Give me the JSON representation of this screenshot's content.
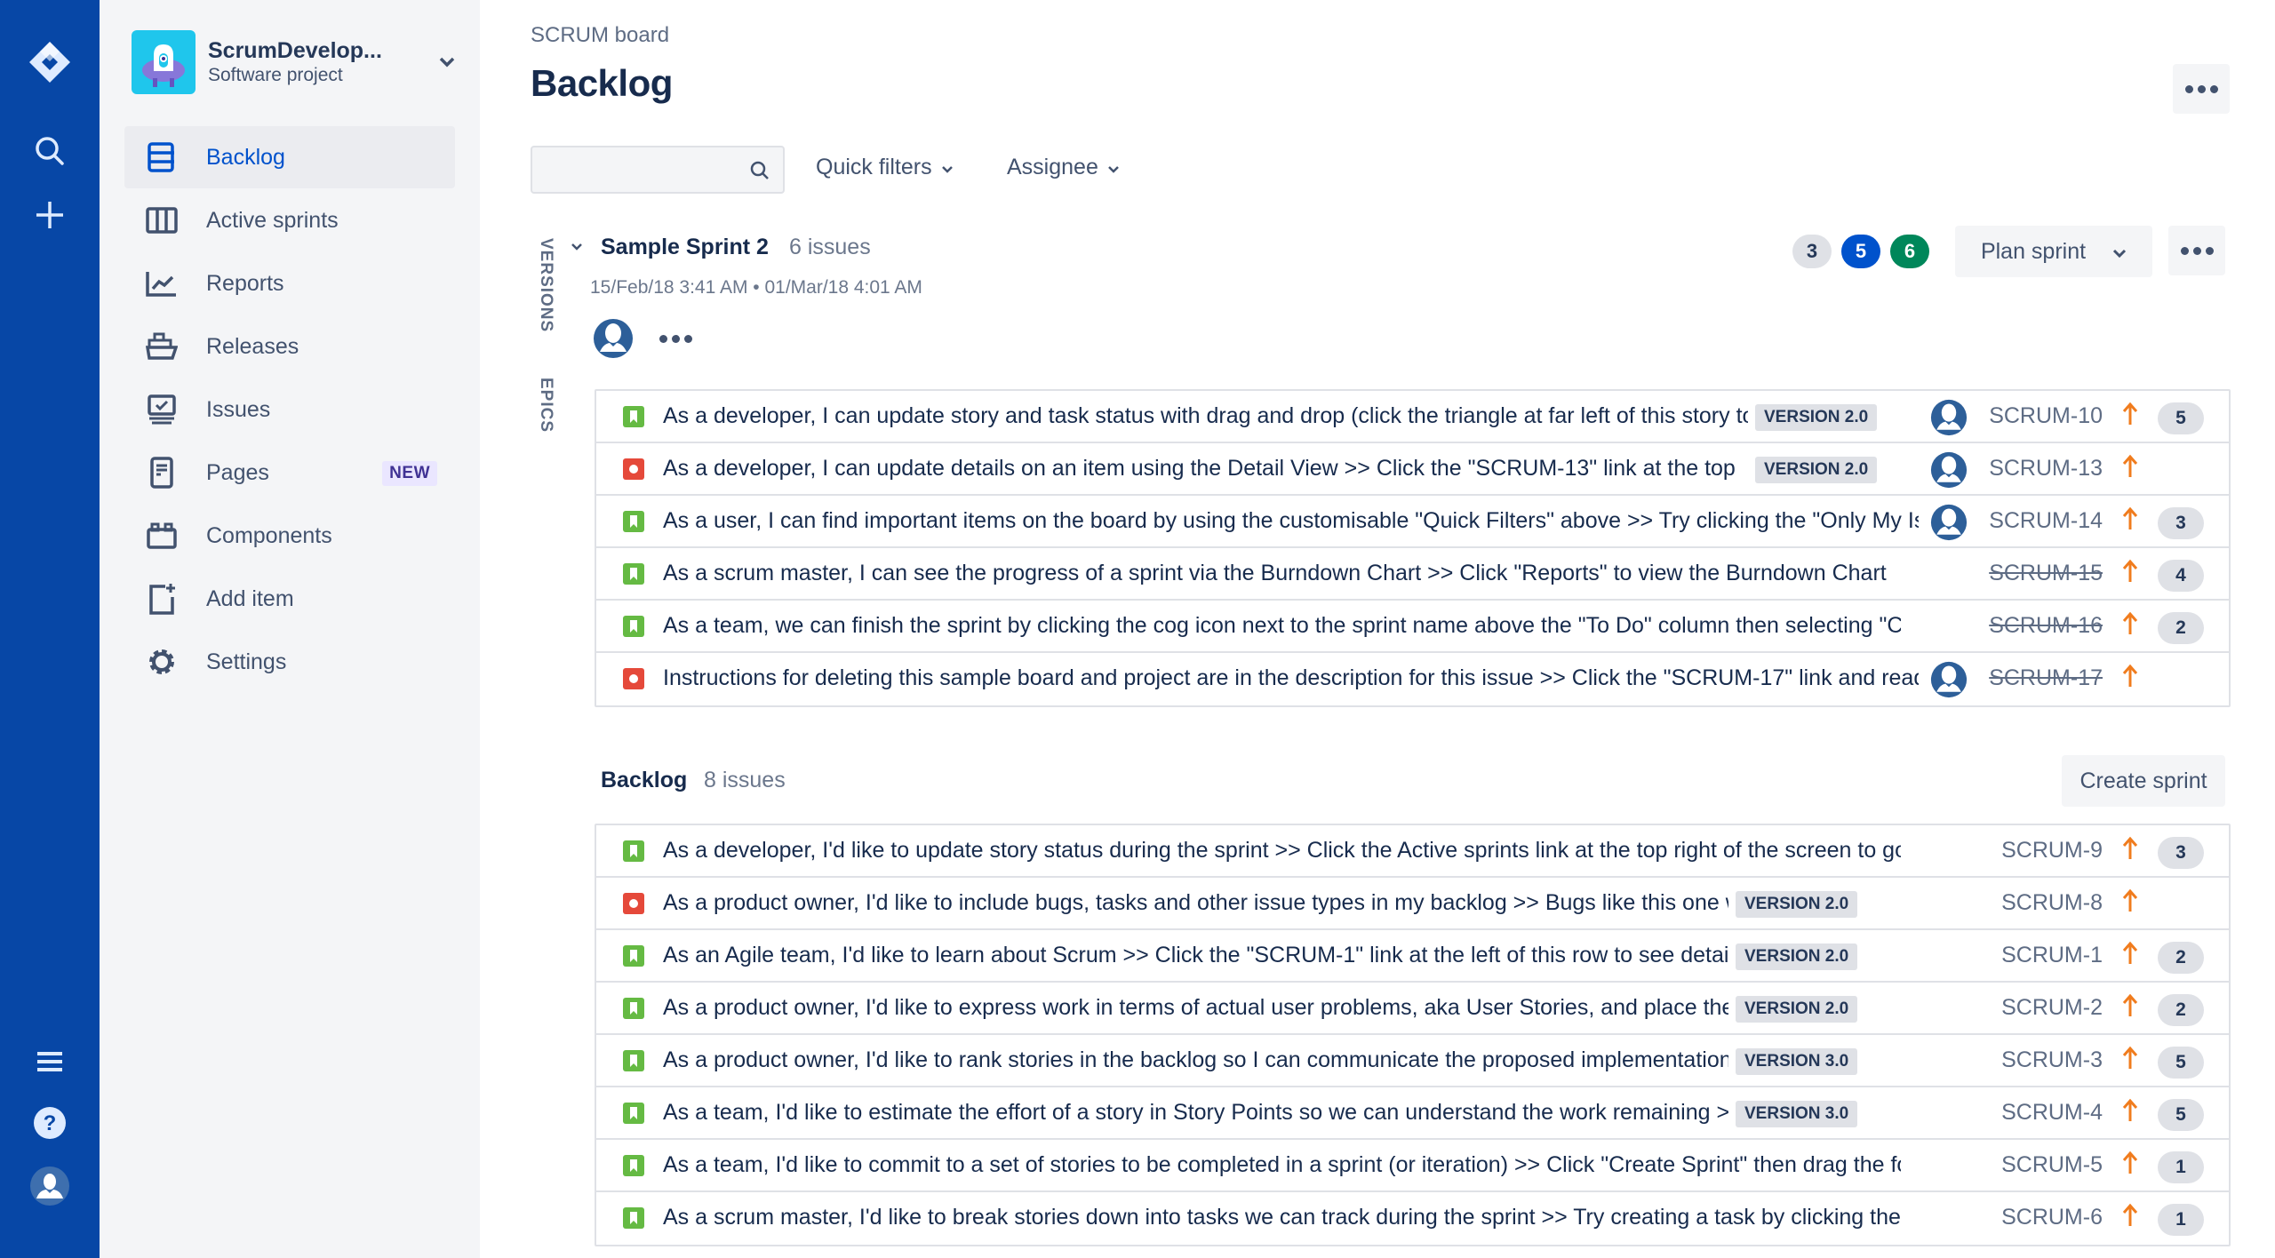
{
  "global_nav": {
    "icons": [
      "jira-logo-icon",
      "search-icon",
      "create-icon",
      "menu-icon",
      "help-icon",
      "profile-icon"
    ]
  },
  "project": {
    "name": "ScrumDevelop...",
    "type": "Software project"
  },
  "sidebar": {
    "items": [
      {
        "label": "Backlog",
        "icon": "backlog-icon",
        "active": true
      },
      {
        "label": "Active sprints",
        "icon": "board-icon"
      },
      {
        "label": "Reports",
        "icon": "graph-line-icon"
      },
      {
        "label": "Releases",
        "icon": "ship-icon"
      },
      {
        "label": "Issues",
        "icon": "issues-icon"
      },
      {
        "label": "Pages",
        "icon": "page-icon",
        "badge": "NEW"
      },
      {
        "label": "Components",
        "icon": "component-icon"
      },
      {
        "label": "Add item",
        "icon": "add-item-icon"
      },
      {
        "label": "Settings",
        "icon": "settings-icon"
      }
    ]
  },
  "header": {
    "breadcrumb": "SCRUM board",
    "title": "Backlog"
  },
  "toolbar": {
    "search_value": "",
    "search_placeholder": "",
    "quick_filters": "Quick filters",
    "assignee": "Assignee"
  },
  "side_panels": {
    "versions": "VERSIONS",
    "epics": "EPICS"
  },
  "sprint": {
    "name": "Sample Sprint 2",
    "count": "6 issues",
    "dates": "15/Feb/18 3:41 AM • 01/Mar/18 4:01 AM",
    "status_counts": {
      "todo": "3",
      "in_progress": "5",
      "done": "6"
    },
    "plan_button": "Plan sprint",
    "issues": [
      {
        "type": "story",
        "summary": "As a developer, I can update story and task status with drag and drop (click the triangle at far left of this story to show sub-tasks)",
        "version": "VERSION 2.0",
        "assignee": true,
        "key": "SCRUM-10",
        "done": false,
        "priority": "high",
        "estimate": "5"
      },
      {
        "type": "bug",
        "summary": "As a developer, I can update details on an item using the Detail View >> Click the \"SCRUM-13\" link at the top",
        "version": "VERSION 2.0",
        "assignee": true,
        "key": "SCRUM-13",
        "done": false,
        "priority": "high",
        "estimate": ""
      },
      {
        "type": "story",
        "summary": "As a user, I can find important items on the board by using the customisable \"Quick Filters\" above >> Try clicking the \"Only My Issues\" Quick Filter above",
        "version": "",
        "assignee": true,
        "key": "SCRUM-14",
        "done": false,
        "priority": "high",
        "estimate": "3"
      },
      {
        "type": "story",
        "summary": "As a scrum master, I can see the progress of a sprint via the Burndown Chart >> Click \"Reports\" to view the Burndown Chart",
        "version": "",
        "assignee": false,
        "key": "SCRUM-15",
        "done": true,
        "priority": "high",
        "estimate": "4"
      },
      {
        "type": "story",
        "summary": "As a team, we can finish the sprint by clicking the cog icon next to the sprint name above the \"To Do\" column then selecting \"Complete Sprint\"",
        "version": "",
        "assignee": false,
        "key": "SCRUM-16",
        "done": true,
        "priority": "high",
        "estimate": "2"
      },
      {
        "type": "bug",
        "summary": "Instructions for deleting this sample board and project are in the description for this issue >> Click the \"SCRUM-17\" link and read the description tab of the detail view for more",
        "version": "",
        "assignee": true,
        "key": "SCRUM-17",
        "done": true,
        "priority": "high",
        "estimate": ""
      }
    ]
  },
  "backlog": {
    "name": "Backlog",
    "count": "8 issues",
    "create_button": "Create sprint",
    "issues": [
      {
        "type": "story",
        "summary": "As a developer, I'd like to update story status during the sprint >> Click the Active sprints link at the top right of the screen to go to the Active sprints view",
        "version": "",
        "key": "SCRUM-9",
        "priority": "high",
        "estimate": "3"
      },
      {
        "type": "bug",
        "summary": "As a product owner, I'd like to include bugs, tasks and other issue types in my backlog >> Bugs like this one will also appear in your backlog",
        "version": "VERSION 2.0",
        "key": "SCRUM-8",
        "priority": "high",
        "estimate": ""
      },
      {
        "type": "story",
        "summary": "As an Agile team, I'd like to learn about Scrum >> Click the \"SCRUM-1\" link at the left of this row to see detail in the Description tab on the right",
        "version": "VERSION 2.0",
        "key": "SCRUM-1",
        "priority": "high",
        "estimate": "2"
      },
      {
        "type": "story",
        "summary": "As a product owner, I'd like to express work in terms of actual user problems, aka User Stories, and place them in the backlog",
        "version": "VERSION 2.0",
        "key": "SCRUM-2",
        "priority": "high",
        "estimate": "2"
      },
      {
        "type": "story",
        "summary": "As a product owner, I'd like to rank stories in the backlog so I can communicate the proposed implementation order",
        "version": "VERSION 3.0",
        "key": "SCRUM-3",
        "priority": "high",
        "estimate": "5"
      },
      {
        "type": "story",
        "summary": "As a team, I'd like to estimate the effort of a story in Story Points so we can understand the work remaining >> Try setting the Story Points for this story",
        "version": "VERSION 3.0",
        "key": "SCRUM-4",
        "priority": "high",
        "estimate": "5"
      },
      {
        "type": "story",
        "summary": "As a team, I'd like to commit to a set of stories to be completed in a sprint (or iteration) >> Click \"Create Sprint\" then drag the footer down to select issues for a sprint",
        "version": "",
        "key": "SCRUM-5",
        "priority": "high",
        "estimate": "1"
      },
      {
        "type": "story",
        "summary": "As a scrum master, I'd like to break stories down into tasks we can track during the sprint >> Try creating a task by clicking the Sub-Tasks tab in the Detail View on the right",
        "version": "",
        "key": "SCRUM-6",
        "priority": "high",
        "estimate": "1"
      }
    ]
  },
  "colors": {
    "global_nav": "#0747A6",
    "sidebar_bg": "#F4F5F7",
    "active": "#0052CC",
    "story": "#65BA43",
    "bug": "#E5493A",
    "priority_high": "#F07C1E",
    "status_todo": "#DFE1E6",
    "status_inprogress": "#0052CC",
    "status_done": "#00875A"
  }
}
